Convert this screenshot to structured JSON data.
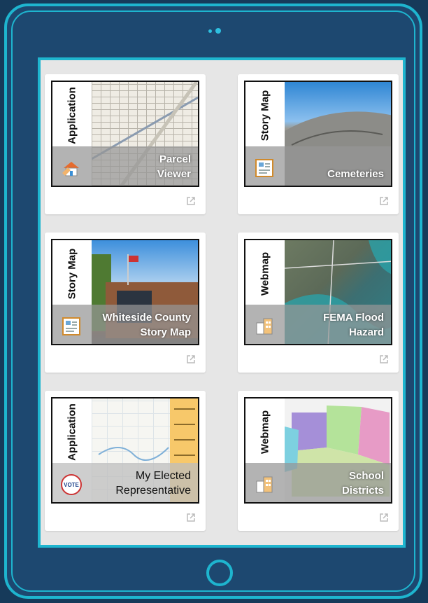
{
  "cards": [
    {
      "type": "Application",
      "title": "Parcel\nViewer",
      "icon": "home-hand-icon"
    },
    {
      "type": "Story Map",
      "title": "Cemeteries",
      "icon": "story-map-icon"
    },
    {
      "type": "Story Map",
      "title": "Whiteside County\nStory Map",
      "icon": "story-map-icon"
    },
    {
      "type": "Webmap",
      "title": "FEMA Flood\nHazard",
      "icon": "buildings-icon"
    },
    {
      "type": "Application",
      "title": "My Elected\nRepresentative",
      "icon": "vote-badge-icon",
      "badge": "VOTE"
    },
    {
      "type": "Webmap",
      "title": "School\nDistricts",
      "icon": "buildings-icon"
    }
  ],
  "colors": {
    "frame": "#1d4870",
    "accent": "#1eb5cf",
    "screen": "#e6e6e6"
  }
}
